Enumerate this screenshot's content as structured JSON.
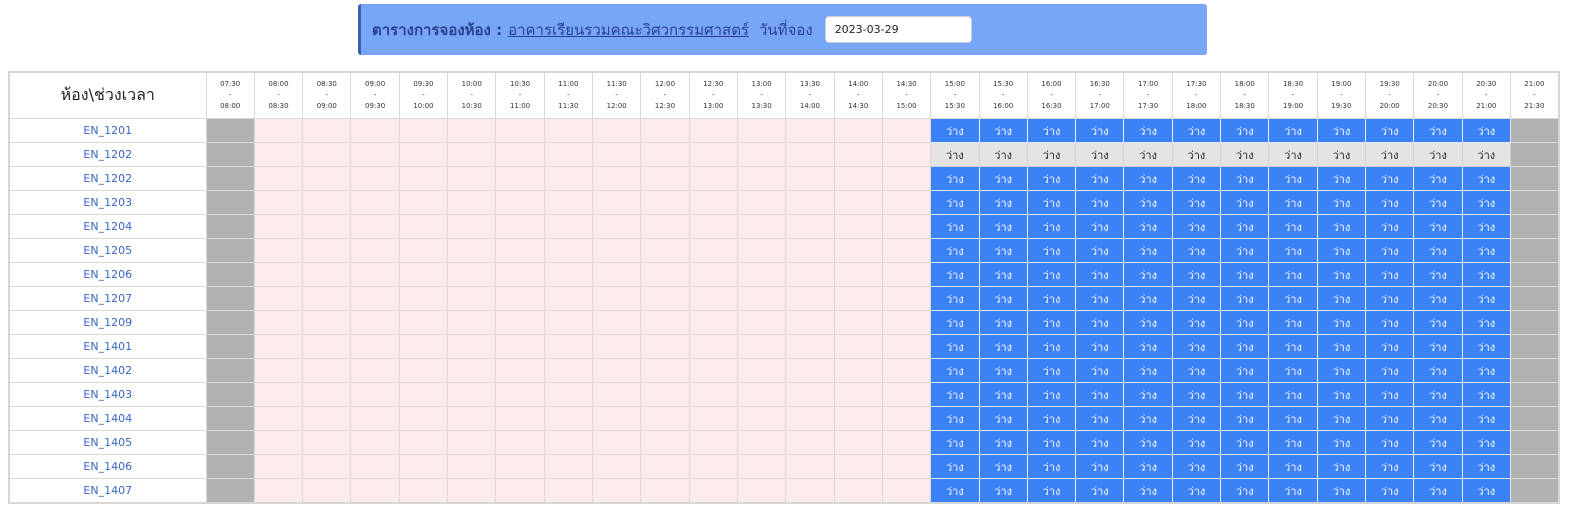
{
  "header": {
    "title": "ตารางการจองห้อง :",
    "building": "อาคารเรียนรวมคณะวิศวกรรมศาสตร์",
    "date_label": "วันที่จอง",
    "date_value": "2023-03-29"
  },
  "table": {
    "corner_label": "ห้อง\\ช่วงเวลา",
    "slots": [
      {
        "start": "07:30",
        "sep": "-",
        "end": "08:00"
      },
      {
        "start": "08:00",
        "sep": "-",
        "end": "08:30"
      },
      {
        "start": "08:30",
        "sep": "-",
        "end": "09:00"
      },
      {
        "start": "09:00",
        "sep": "-",
        "end": "09:30"
      },
      {
        "start": "09:30",
        "sep": "-",
        "end": "10:00"
      },
      {
        "start": "10:00",
        "sep": "-",
        "end": "10:30"
      },
      {
        "start": "10:30",
        "sep": "-",
        "end": "11:00"
      },
      {
        "start": "11:00",
        "sep": "-",
        "end": "11:30"
      },
      {
        "start": "11:30",
        "sep": "-",
        "end": "12:00"
      },
      {
        "start": "12:00",
        "sep": "-",
        "end": "12:30"
      },
      {
        "start": "12:30",
        "sep": "-",
        "end": "13:00"
      },
      {
        "start": "13:00",
        "sep": "-",
        "end": "13:30"
      },
      {
        "start": "13:30",
        "sep": "-",
        "end": "14:00"
      },
      {
        "start": "14:00",
        "sep": "-",
        "end": "14:30"
      },
      {
        "start": "14:30",
        "sep": "-",
        "end": "15:00"
      },
      {
        "start": "15:00",
        "sep": "-",
        "end": "15:30"
      },
      {
        "start": "15:30",
        "sep": "-",
        "end": "16:00"
      },
      {
        "start": "16:00",
        "sep": "-",
        "end": "16:30"
      },
      {
        "start": "16:30",
        "sep": "-",
        "end": "17:00"
      },
      {
        "start": "17:00",
        "sep": "-",
        "end": "17:30"
      },
      {
        "start": "17:30",
        "sep": "-",
        "end": "18:00"
      },
      {
        "start": "18:00",
        "sep": "-",
        "end": "18:30"
      },
      {
        "start": "18:30",
        "sep": "-",
        "end": "19:00"
      },
      {
        "start": "19:00",
        "sep": "-",
        "end": "19:30"
      },
      {
        "start": "19:30",
        "sep": "-",
        "end": "20:00"
      },
      {
        "start": "20:00",
        "sep": "-",
        "end": "20:30"
      },
      {
        "start": "20:30",
        "sep": "-",
        "end": "21:00"
      },
      {
        "start": "21:00",
        "sep": "-",
        "end": "21:30"
      }
    ],
    "free_label": "ว่าง",
    "rooms": [
      {
        "name": "EN_1201",
        "style": "free"
      },
      {
        "name": "EN_1202",
        "style": "grey"
      },
      {
        "name": "EN_1202",
        "style": "free"
      },
      {
        "name": "EN_1203",
        "style": "free"
      },
      {
        "name": "EN_1204",
        "style": "free"
      },
      {
        "name": "EN_1205",
        "style": "free"
      },
      {
        "name": "EN_1206",
        "style": "free"
      },
      {
        "name": "EN_1207",
        "style": "free"
      },
      {
        "name": "EN_1209",
        "style": "free"
      },
      {
        "name": "EN_1401",
        "style": "free"
      },
      {
        "name": "EN_1402",
        "style": "free"
      },
      {
        "name": "EN_1403",
        "style": "free"
      },
      {
        "name": "EN_1404",
        "style": "free"
      },
      {
        "name": "EN_1405",
        "style": "free"
      },
      {
        "name": "EN_1406",
        "style": "free"
      },
      {
        "name": "EN_1407",
        "style": "free"
      }
    ],
    "slot_states": [
      "closed",
      "past",
      "past",
      "past",
      "past",
      "past",
      "past",
      "past",
      "past",
      "past",
      "past",
      "past",
      "past",
      "past",
      "past",
      "open",
      "open",
      "open",
      "open",
      "open",
      "open",
      "open",
      "open",
      "open",
      "open",
      "open",
      "open",
      "closed"
    ]
  },
  "colors": {
    "header_bg": "#78a6f7",
    "free_bg": "#3b82f6",
    "past_bg": "#fdeaea",
    "closed_bg": "#b2b2b2",
    "grey_free_bg": "#e4e4e4",
    "room_link": "#3a64c8"
  }
}
